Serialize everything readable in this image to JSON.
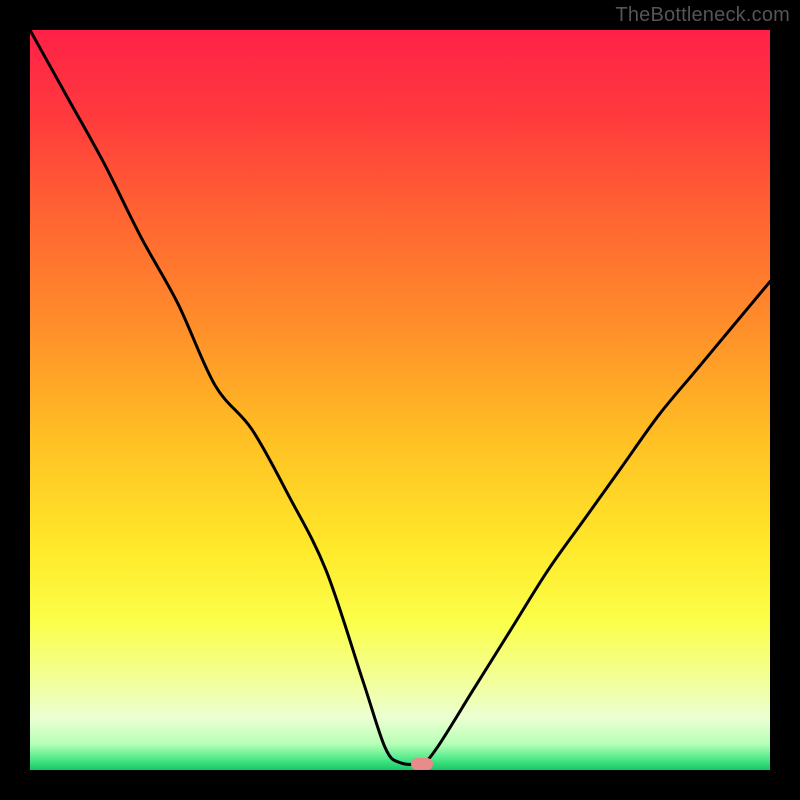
{
  "watermark": "TheBottleneck.com",
  "marker": {
    "x_pct": 53,
    "y_pct": 99.2,
    "color": "#e88b8b"
  },
  "gradient_stops": [
    {
      "offset": 0.0,
      "color": "#ff2147"
    },
    {
      "offset": 0.12,
      "color": "#ff3b3d"
    },
    {
      "offset": 0.25,
      "color": "#ff6432"
    },
    {
      "offset": 0.4,
      "color": "#ff8e2a"
    },
    {
      "offset": 0.55,
      "color": "#ffbf24"
    },
    {
      "offset": 0.7,
      "color": "#ffe92a"
    },
    {
      "offset": 0.8,
      "color": "#fbff4a"
    },
    {
      "offset": 0.88,
      "color": "#f2ff9a"
    },
    {
      "offset": 0.93,
      "color": "#ebffd2"
    },
    {
      "offset": 0.965,
      "color": "#b6ffb6"
    },
    {
      "offset": 0.985,
      "color": "#4fe98a"
    },
    {
      "offset": 1.0,
      "color": "#16c862"
    }
  ],
  "chart_data": {
    "type": "line",
    "title": "",
    "xlabel": "",
    "ylabel": "",
    "xlim": [
      0,
      100
    ],
    "ylim": [
      0,
      100
    ],
    "series": [
      {
        "name": "bottleneck-curve",
        "x": [
          0,
          5,
          10,
          15,
          20,
          25,
          30,
          35,
          40,
          45,
          48,
          50,
          53,
          55,
          60,
          65,
          70,
          75,
          80,
          85,
          90,
          95,
          100
        ],
        "y": [
          100,
          91,
          82,
          72,
          63,
          52,
          46,
          37,
          27,
          12,
          3,
          1,
          1,
          3,
          11,
          19,
          27,
          34,
          41,
          48,
          54,
          60,
          66
        ]
      }
    ],
    "annotations": []
  }
}
